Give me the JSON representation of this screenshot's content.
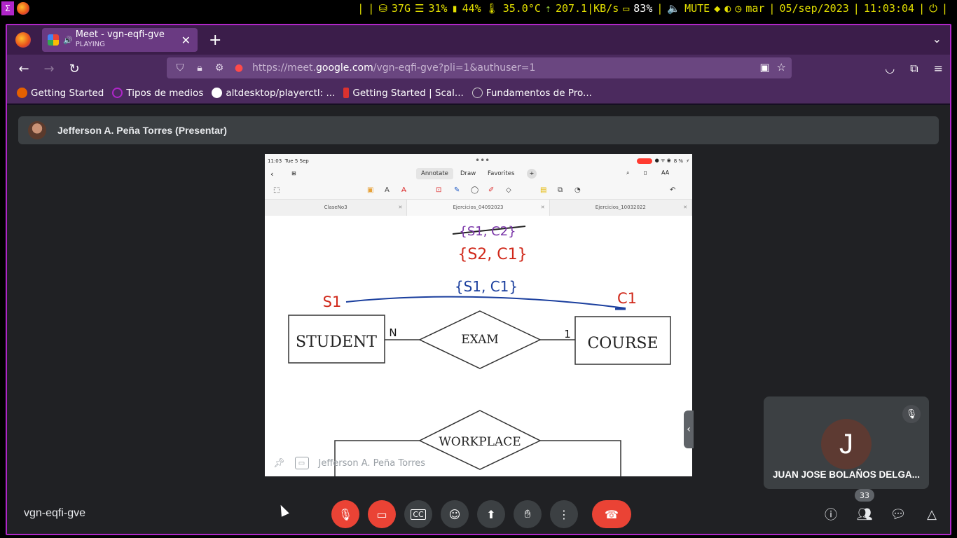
{
  "statusbar": {
    "disk": "37G",
    "cpu": "31%",
    "mem": "44%",
    "temp": "35.0°C",
    "net": "207.1|KB/s",
    "battery": "83%",
    "volume": "MUTE",
    "day": "mar",
    "date": "05/sep/2023",
    "time": "11:03:04"
  },
  "browser": {
    "tab_title": "Meet - vgn-eqfi-gve",
    "tab_subtitle": "PLAYING",
    "url_prefix": "https://meet.",
    "url_host": "google.com",
    "url_path": "/vgn-eqfi-gve?pli=1&authuser=1",
    "bookmarks": [
      {
        "label": "Getting Started",
        "color": "#e66000"
      },
      {
        "label": "Tipos de medios",
        "color": "#b026c9"
      },
      {
        "label": "altdesktop/playerctl: ...",
        "color": "#ffffff"
      },
      {
        "label": "Getting Started | Scal...",
        "color": "#dc322f"
      },
      {
        "label": "Fundamentos de Pro...",
        "color": "#cfcfcf"
      }
    ]
  },
  "meet": {
    "presenter": "Jefferson A. Peña Torres (Presentar)",
    "share_footer": "Jefferson A. Peña Torres",
    "participant_initial": "J",
    "participant_name": "JUAN JOSE BOLAÑOS DELGA...",
    "meeting_code": "vgn-eqfi-gve",
    "participant_count": "33",
    "accent_red": "#ea4335"
  },
  "ipad": {
    "time": "11:03",
    "date": "Tue 5 Sep",
    "battery": "8 %",
    "menu": [
      "Annotate",
      "Draw",
      "Favorites"
    ],
    "docs": [
      "ClaseNo3",
      "Ejercicios_04092023",
      "Ejercicios_10032022"
    ]
  },
  "diagram": {
    "entity_left": "STUDENT",
    "entity_right": "COURSE",
    "relationship": "EXAM",
    "relationship2": "WORKPLACE",
    "card_left": "N",
    "card_right": "1",
    "ann_s1": "S1",
    "ann_c1": "C1",
    "ann_set_struck": "{S1, C2}",
    "ann_set_red": "{S2, C1}",
    "ann_set_blue": "{S1, C1}"
  }
}
